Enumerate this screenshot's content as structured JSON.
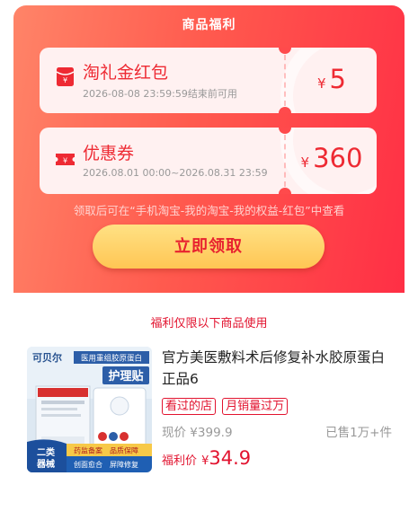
{
  "header": {
    "title": "商品福利"
  },
  "coupons": [
    {
      "icon": "red-envelope-icon",
      "title": "淘礼金红包",
      "subtitle": "2026-08-08 23:59:59结束前可用",
      "currency": "¥",
      "amount": "5"
    },
    {
      "icon": "ticket-icon",
      "title": "优惠券",
      "subtitle": "2026.08.01 00:00~2026.08.31 23:59",
      "currency": "¥",
      "amount": "360"
    }
  ],
  "notice": "领取后可在“手机淘宝-我的淘宝-我的权益-红包”中查看",
  "claim_button": {
    "label": "立即领取"
  },
  "limit_text": "福利仅限以下商品使用",
  "product": {
    "name": "官方美医敷料术后修复补水胶原蛋白正品6",
    "tags": [
      "看过的店",
      "月销量过万"
    ],
    "current_price_label": "现价",
    "current_price": "¥399.9",
    "sold": "已售1万+件",
    "welfare_label": "福利价",
    "welfare_currency": "¥",
    "welfare_price": "34.9",
    "image_text": {
      "brand": "可贝尔",
      "subtitle": "医用重组胶原蛋白",
      "headline": "护理贴",
      "badge_line1": "二类",
      "badge_line2": "器械",
      "strip_left": "药监备案",
      "strip_right": "品质保障",
      "bottom_left": "创面愈合",
      "bottom_right": "屏障修复"
    }
  },
  "colors": {
    "accent_red": "#e2132f",
    "header_gradient_start": "#ff8468",
    "header_gradient_end": "#ff2f45",
    "button_gold": "#ffc654"
  }
}
